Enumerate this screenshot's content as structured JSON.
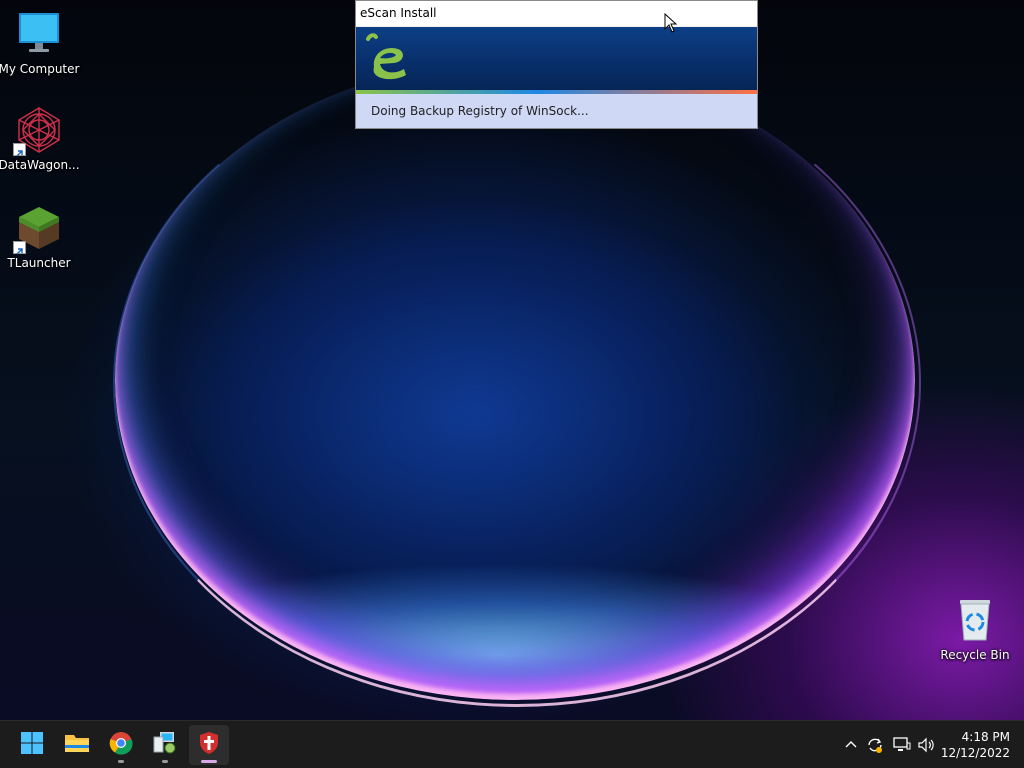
{
  "desktop": {
    "icons": [
      {
        "label": "My Computer",
        "icon": "monitor-icon"
      },
      {
        "label": "DataWagon...",
        "icon": "datawagon-icon"
      },
      {
        "label": "TLauncher",
        "icon": "minecraft-grass-block-icon"
      },
      {
        "label": "Recycle Bin",
        "icon": "recycle-bin-icon"
      }
    ]
  },
  "installer": {
    "title": "eScan Install",
    "status": "Doing Backup Registry of WinSock...",
    "logo": "escan-logo-icon",
    "colors": {
      "banner": "#0a3778",
      "status_bg": "#cfd8f5"
    }
  },
  "taskbar": {
    "apps": [
      {
        "name": "Start",
        "icon": "windows-start-icon"
      },
      {
        "name": "File Explorer",
        "icon": "file-explorer-icon"
      },
      {
        "name": "Google Chrome",
        "icon": "chrome-icon"
      },
      {
        "name": "Network",
        "icon": "network-computer-icon"
      },
      {
        "name": "eScan",
        "icon": "escan-shield-icon"
      }
    ],
    "tray": {
      "icons": [
        "chevron-up-icon",
        "sync-icon",
        "network-icon",
        "volume-icon"
      ]
    },
    "clock": {
      "time": "4:18 PM",
      "date": "12/12/2022"
    }
  }
}
